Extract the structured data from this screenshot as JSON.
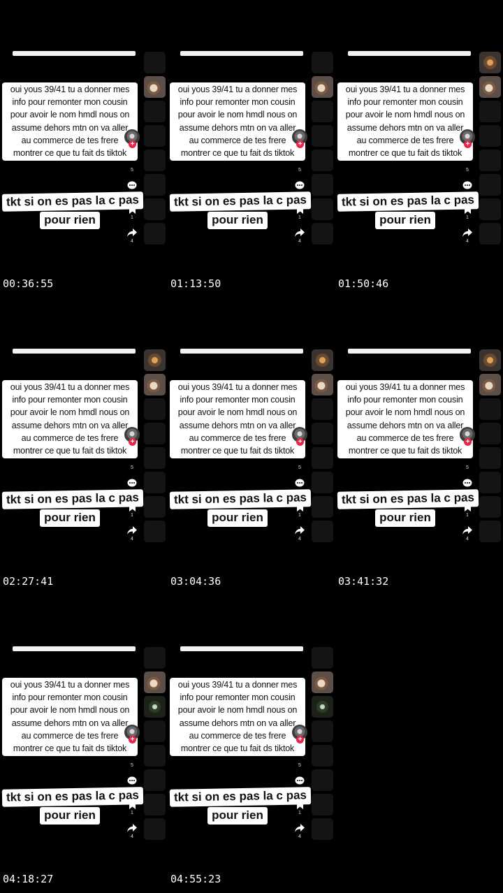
{
  "caption_lines": [
    "oui yous 39/41 tu a donner mes",
    "info pour remonter mon cousin",
    "pour avoir le nom hmdl nous on",
    "assume dehors mtn on va aller",
    "au commerce de tes frere",
    "montrer ce que tu fait ds tiktok"
  ],
  "subtitle": {
    "line1": "tkt si on es pas la c pas",
    "line2": "pour rien"
  },
  "counts": {
    "likes": "5",
    "saves": "1",
    "shares": "4"
  },
  "frames": [
    {
      "timestamp": "00:36:55",
      "strip": [
        "empty",
        "thumb-a",
        "empty",
        "empty",
        "empty",
        "empty",
        "empty",
        "empty"
      ]
    },
    {
      "timestamp": "01:13:50",
      "strip": [
        "empty",
        "thumb-a",
        "empty",
        "empty",
        "empty",
        "empty",
        "empty",
        "empty"
      ]
    },
    {
      "timestamp": "01:50:46",
      "strip": [
        "thumb-b",
        "thumb-a",
        "empty",
        "empty",
        "empty",
        "empty",
        "empty",
        "empty"
      ]
    },
    {
      "timestamp": "02:27:41",
      "strip": [
        "thumb-b",
        "thumb-a",
        "empty",
        "empty",
        "empty",
        "empty",
        "empty",
        "empty"
      ]
    },
    {
      "timestamp": "03:04:36",
      "strip": [
        "thumb-b",
        "thumb-a",
        "empty",
        "empty",
        "empty",
        "empty",
        "empty",
        "empty"
      ]
    },
    {
      "timestamp": "03:41:32",
      "strip": [
        "thumb-b",
        "thumb-a",
        "empty",
        "empty",
        "empty",
        "empty",
        "empty",
        "empty"
      ]
    },
    {
      "timestamp": "04:18:27",
      "strip": [
        "empty",
        "thumb-a",
        "thumb-c",
        "empty",
        "empty",
        "empty",
        "empty",
        "empty"
      ]
    },
    {
      "timestamp": "04:55:23",
      "strip": [
        "empty",
        "thumb-a",
        "thumb-c",
        "empty",
        "empty",
        "empty",
        "empty",
        "empty"
      ]
    }
  ],
  "colors": {
    "background": "#000000",
    "caption_bg": "#ffffff",
    "follow_plus": "#e8254b"
  },
  "icons": [
    "comment-icon",
    "bookmark-icon",
    "share-icon",
    "follow-plus-icon"
  ]
}
